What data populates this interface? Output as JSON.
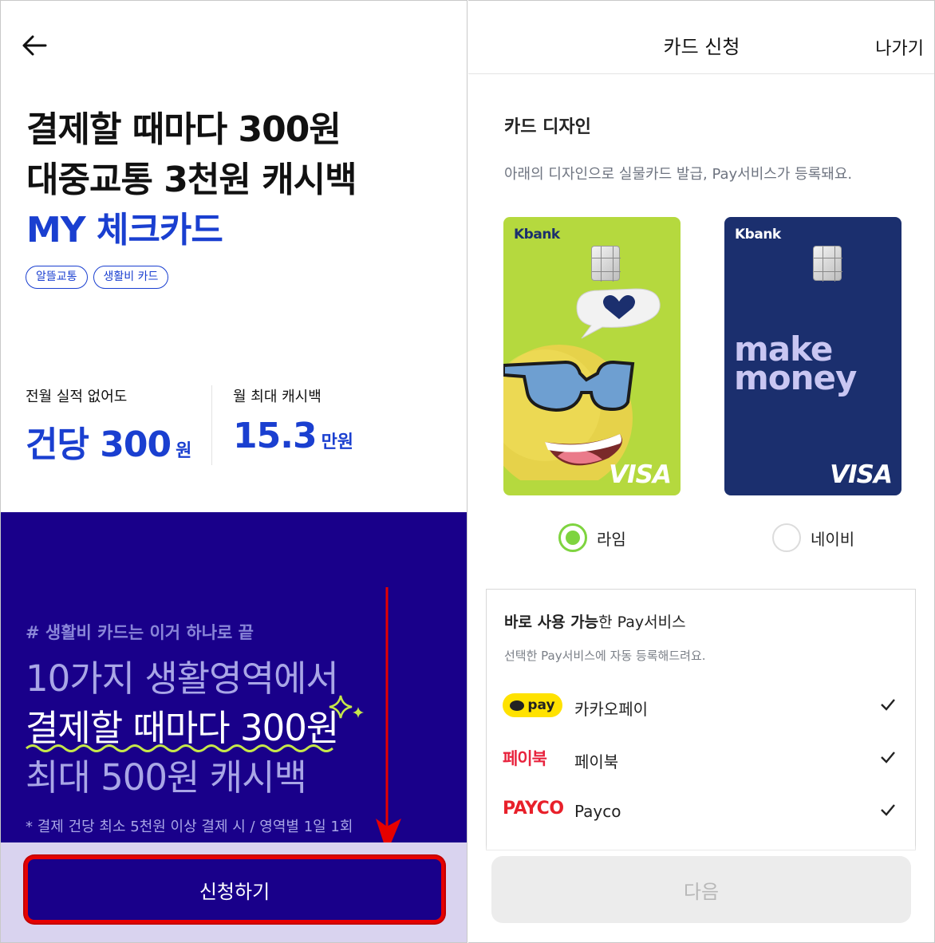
{
  "left": {
    "headline": {
      "line1": "결제할 때마다 300원",
      "line2": "대중교통 3천원 캐시백",
      "line3": "MY 체크카드"
    },
    "tags": [
      "알뜰교통",
      "생활비 카드"
    ],
    "stats": [
      {
        "caption": "전월 실적 없어도",
        "value": "건당 300",
        "unit": "원"
      },
      {
        "caption": "월 최대 캐시백",
        "value": "15.3",
        "unit": "만원"
      }
    ],
    "promo": {
      "hashtag": "# 생활비 카드는 이거 하나로 끝",
      "line1": "10가지 생활영역에서",
      "line2": "결제할 때마다 300원",
      "line3": "최대 500원 캐시백",
      "fine": "* 결제 건당 최소 5천원 이상 결제 시 / 영역별 1일 1회"
    },
    "cta_label": "신청하기"
  },
  "right": {
    "title": "카드 신청",
    "exit_label": "나가기",
    "section_title": "카드 디자인",
    "section_desc": "아래의 디자인으로 실물카드 발급, Pay서비스가 등록돼요.",
    "cards": [
      {
        "brand": "Kbank",
        "network": "VISA",
        "option": "라임",
        "selected": true
      },
      {
        "brand": "Kbank",
        "network": "VISA",
        "option": "네이비",
        "selected": false,
        "text_line1": "make",
        "text_line2": "money"
      }
    ],
    "pay": {
      "title_bold": "바로 사용 가능",
      "title_rest": "한 Pay서비스",
      "desc": "선택한 Pay서비스에 자동 등록해드려요.",
      "items": [
        {
          "logo_text": "pay",
          "name": "카카오페이",
          "checked": true
        },
        {
          "logo_text": "페이북",
          "name": "페이북",
          "checked": true
        },
        {
          "logo_text": "PAYCO",
          "name": "Payco",
          "checked": true
        }
      ]
    },
    "next_label": "다음"
  },
  "colors": {
    "accent_blue": "#1a3fd0",
    "promo_bg": "#19008a",
    "highlight_red": "#e60000",
    "lime": "#b5d93e",
    "navy": "#1b2f6e"
  }
}
